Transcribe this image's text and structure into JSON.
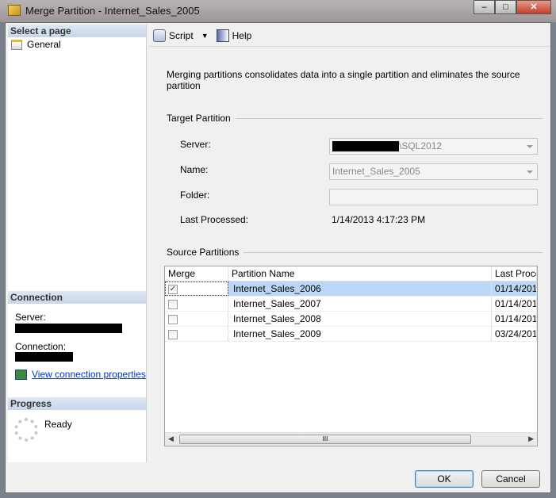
{
  "window": {
    "title": "Merge Partition - Internet_Sales_2005"
  },
  "sidebar": {
    "select_page_header": "Select a page",
    "pages": [
      {
        "label": "General"
      }
    ],
    "connection_header": "Connection",
    "server_label": "Server:",
    "connection_label": "Connection:",
    "view_connection_link": "View connection properties",
    "progress_header": "Progress",
    "progress_status": "Ready"
  },
  "toolbar": {
    "script_label": "Script",
    "help_label": "Help"
  },
  "main": {
    "description": "Merging partitions consolidates data into a single partition and eliminates the source partition",
    "target_group": "Target Partition",
    "server_label": "Server:",
    "server_value": "\\SQL2012",
    "name_label": "Name:",
    "name_value": "Internet_Sales_2005",
    "folder_label": "Folder:",
    "folder_value": "",
    "last_processed_label": "Last Processed:",
    "last_processed_value": "1/14/2013 4:17:23 PM",
    "source_group": "Source Partitions",
    "columns": [
      "Merge",
      "Partition Name",
      "Last Proces"
    ],
    "rows": [
      {
        "checked": true,
        "name": "Internet_Sales_2006",
        "last": "01/14/201"
      },
      {
        "checked": false,
        "name": "Internet_Sales_2007",
        "last": "01/14/201"
      },
      {
        "checked": false,
        "name": "Internet_Sales_2008",
        "last": "01/14/201"
      },
      {
        "checked": false,
        "name": "Internet_Sales_2009",
        "last": "03/24/201"
      }
    ],
    "scroll_grip": "III"
  },
  "buttons": {
    "ok": "OK",
    "cancel": "Cancel"
  }
}
